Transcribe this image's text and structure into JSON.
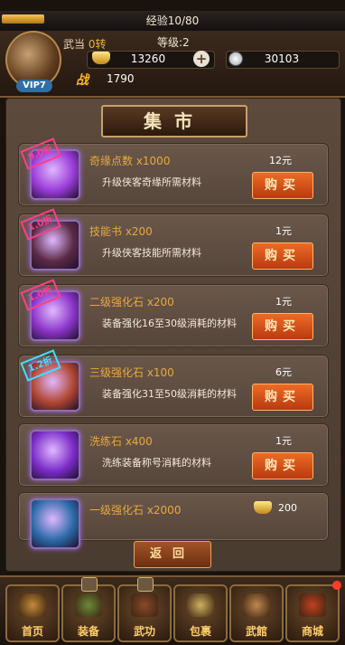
{
  "exp": {
    "label": "经验10/80",
    "fraction": 0.125
  },
  "player": {
    "sect": "武当",
    "turn": "0转",
    "level": "等级:2",
    "vip": "VIP7",
    "battle_label": "战",
    "battle_value": "1790"
  },
  "currency": {
    "gold": "13260",
    "silver": "30103",
    "plus": "+"
  },
  "shop": {
    "title": "集市",
    "buy_label": "购买",
    "items": [
      {
        "name": "奇缘点数 x1000",
        "desc": "升级侠客奇缘所需材料",
        "price": "12元",
        "badge": "9.0折",
        "icon": "purple-gem-icon",
        "color": "#9a3bd8"
      },
      {
        "name": "技能书 x200",
        "desc": "升级侠客技能所需材料",
        "price": "1元",
        "badge": "1.0折",
        "icon": "skill-book-icon",
        "color": "#5a2a45"
      },
      {
        "name": "二级强化石 x200",
        "desc": "装备强化16至30级消耗的材料",
        "price": "1元",
        "badge": "1.0折",
        "icon": "purple-crystal-icon",
        "color": "#8a34c8"
      },
      {
        "name": "三级强化石 x100",
        "desc": "装备强化31至50级消耗的材料",
        "price": "6元",
        "badge": "1.2折",
        "icon": "red-crystal-icon",
        "color": "#b04632"
      },
      {
        "name": "洗练石 x400",
        "desc": "洗练装备称号消耗的材料",
        "price": "1元",
        "badge": "",
        "icon": "purple-orb-icon",
        "color": "#7a2cc8"
      },
      {
        "name": "一级强化石 x2000",
        "desc": "",
        "price": "200",
        "badge": "",
        "icon": "blue-crystal-icon",
        "color": "#2c6aa8"
      }
    ],
    "return_label": "返回"
  },
  "nav": [
    {
      "label": "首页",
      "icon": "scroll-icon",
      "locked": false,
      "dot": false
    },
    {
      "label": "装备",
      "icon": "armor-icon",
      "locked": true,
      "dot": false
    },
    {
      "label": "武功",
      "icon": "weapon-icon",
      "locked": true,
      "dot": false
    },
    {
      "label": "包裹",
      "icon": "bag-icon",
      "locked": false,
      "dot": false
    },
    {
      "label": "武館",
      "icon": "hall-icon",
      "locked": false,
      "dot": false
    },
    {
      "label": "商城",
      "icon": "shop-icon",
      "locked": false,
      "dot": true
    }
  ]
}
